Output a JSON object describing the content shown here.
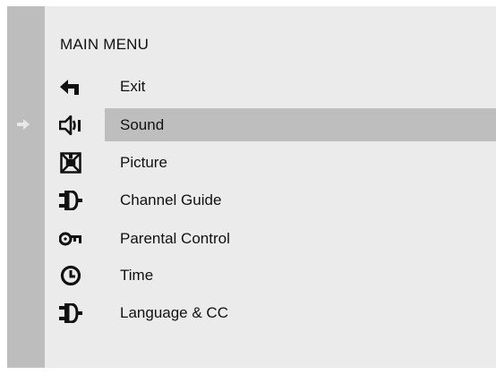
{
  "menu": {
    "title": "MAIN MENU",
    "selected_index": 1,
    "items": [
      {
        "label": "Exit",
        "icon": "exit-arrow-icon"
      },
      {
        "label": "Sound",
        "icon": "speaker-icon"
      },
      {
        "label": "Picture",
        "icon": "picture-icon"
      },
      {
        "label": "Channel Guide",
        "icon": "plug-icon"
      },
      {
        "label": "Parental Control",
        "icon": "key-icon"
      },
      {
        "label": "Time",
        "icon": "clock-icon"
      },
      {
        "label": "Language & CC",
        "icon": "plug-icon"
      }
    ]
  },
  "colors": {
    "panel": "#ebebeb",
    "rail": "#bdbdbd",
    "highlight": "#bebebe",
    "text": "#111111"
  }
}
